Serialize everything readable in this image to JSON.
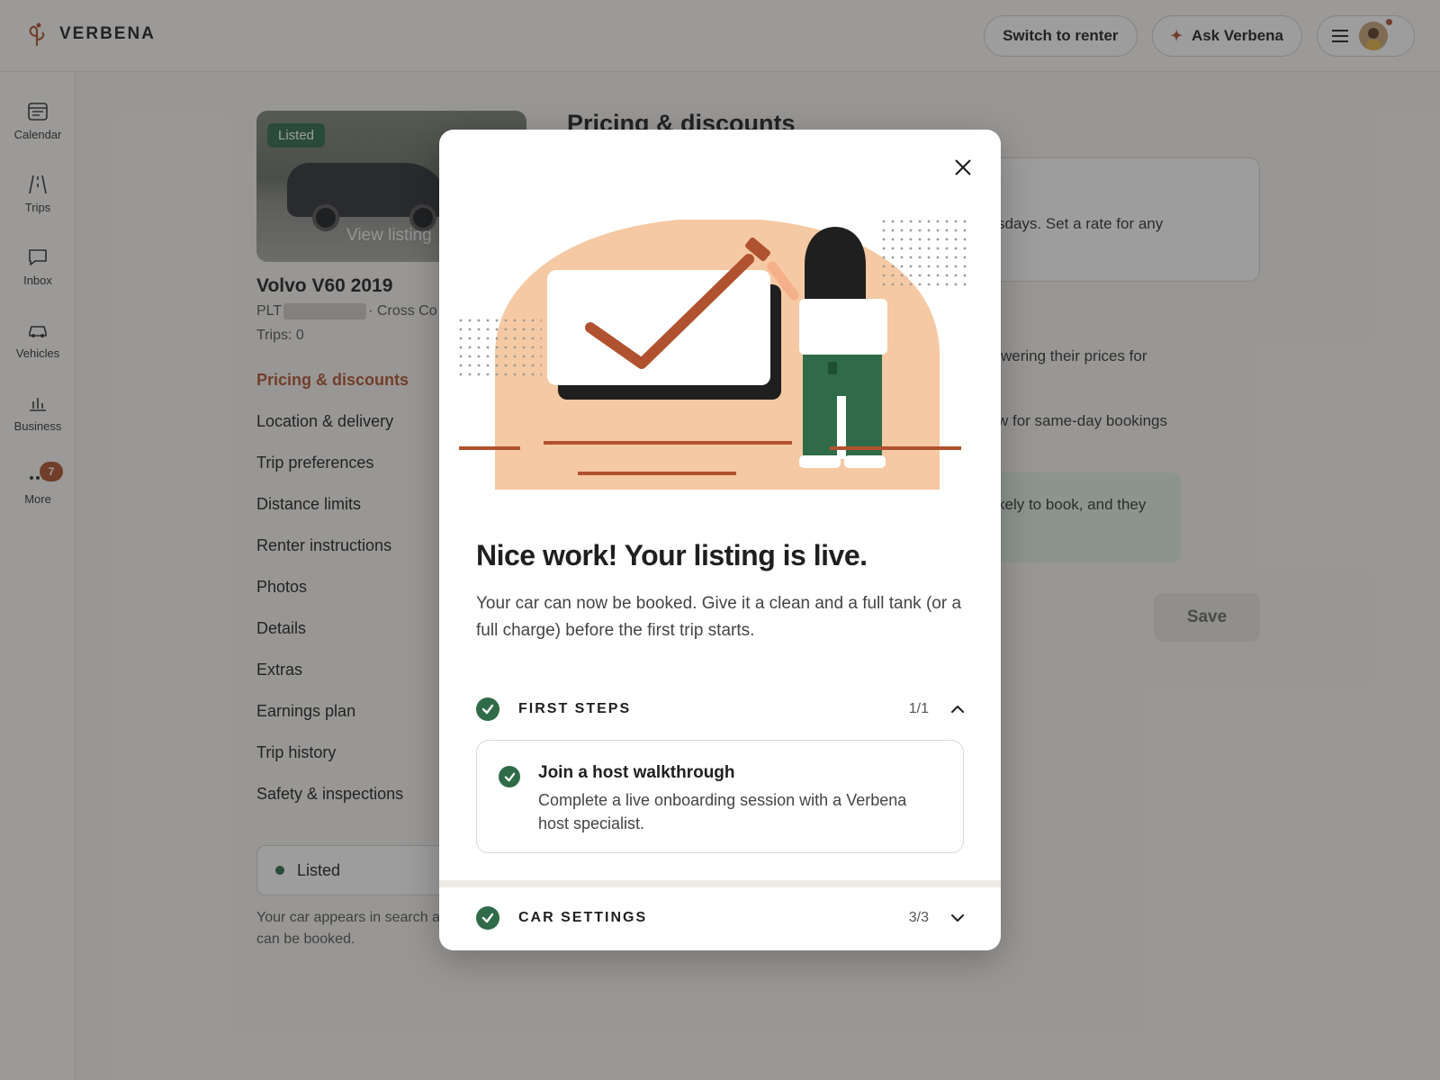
{
  "header": {
    "brand": "VERBENA",
    "switch_label": "Switch to renter",
    "ask_label": "Ask Verbena"
  },
  "rail": {
    "items": [
      {
        "label": "Calendar",
        "icon": "calendar-icon"
      },
      {
        "label": "Trips",
        "icon": "road-icon"
      },
      {
        "label": "Inbox",
        "icon": "chat-bubble-icon"
      },
      {
        "label": "Vehicles",
        "icon": "car-icon"
      },
      {
        "label": "Business",
        "icon": "bar-chart-icon"
      },
      {
        "label": "More",
        "icon": "more-dots-icon",
        "badge": "7"
      }
    ]
  },
  "listing": {
    "tag": "Listed",
    "view_listing": "View listing",
    "title": "Volvo V60 2019",
    "plate_prefix": "PLT",
    "meta_suffix": "· Cross Co",
    "trips": "Trips: 0"
  },
  "side_nav": [
    "Pricing & discounts",
    "Location & delivery",
    "Trip preferences",
    "Distance limits",
    "Renter instructions",
    "Photos",
    "Details",
    "Extras",
    "Earnings plan",
    "Trip history",
    "Safety & inspections"
  ],
  "status": {
    "label": "Listed",
    "desc": "Your car appears in search and can be booked."
  },
  "main": {
    "heading": "Pricing & discounts",
    "frag1": "sdays. Set a rate for any",
    "frag2": "wering their prices for",
    "frag3": "w for same-day bookings",
    "frag4": "kely to book, and they",
    "save_label": "Save"
  },
  "modal": {
    "title": "Nice work! Your listing is live.",
    "body": "Your car can now be booked. Give it a clean and a full tank (or a full charge) before the first trip starts.",
    "sections": [
      {
        "name": "FIRST STEPS",
        "count": "1/1",
        "expanded": true,
        "tasks": [
          {
            "title": "Join a host walkthrough",
            "desc": "Complete a live onboarding session with a Verbena host specialist."
          }
        ]
      },
      {
        "name": "CAR SETTINGS",
        "count": "3/3",
        "expanded": false
      }
    ]
  },
  "colors": {
    "accent": "#b0522f",
    "success": "#2f6b48",
    "peach": "#f5c9a3",
    "ink": "#1f1f1f"
  }
}
